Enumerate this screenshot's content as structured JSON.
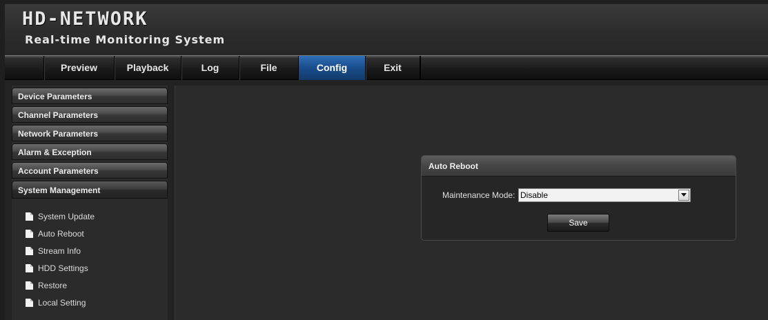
{
  "header": {
    "title": "HD-NETWORK",
    "subtitle": "Real-time Monitoring System"
  },
  "nav": {
    "tabs": [
      {
        "label": "Preview"
      },
      {
        "label": "Playback"
      },
      {
        "label": "Log"
      },
      {
        "label": "File"
      },
      {
        "label": "Config",
        "active": true
      },
      {
        "label": "Exit"
      }
    ]
  },
  "sidebar": {
    "sections": [
      {
        "label": "Device Parameters"
      },
      {
        "label": "Channel Parameters"
      },
      {
        "label": "Network Parameters"
      },
      {
        "label": "Alarm & Exception"
      },
      {
        "label": "Account Parameters"
      },
      {
        "label": "System Management",
        "expanded": true
      }
    ],
    "items": [
      {
        "label": "System Update",
        "icon": "document-icon"
      },
      {
        "label": "Auto Reboot",
        "icon": "document-icon"
      },
      {
        "label": "Stream Info",
        "icon": "document-icon"
      },
      {
        "label": "HDD Settings",
        "icon": "document-icon"
      },
      {
        "label": "Restore",
        "icon": "document-icon"
      },
      {
        "label": "Local Setting",
        "icon": "document-icon"
      }
    ]
  },
  "panel": {
    "title": "Auto Reboot",
    "maintenance_mode_label": "Maintenance Mode:",
    "maintenance_mode_value": "Disable",
    "save_label": "Save"
  },
  "colors": {
    "active_tab": "#1b4f8e",
    "background": "#232323",
    "panel_header": "#454545"
  }
}
